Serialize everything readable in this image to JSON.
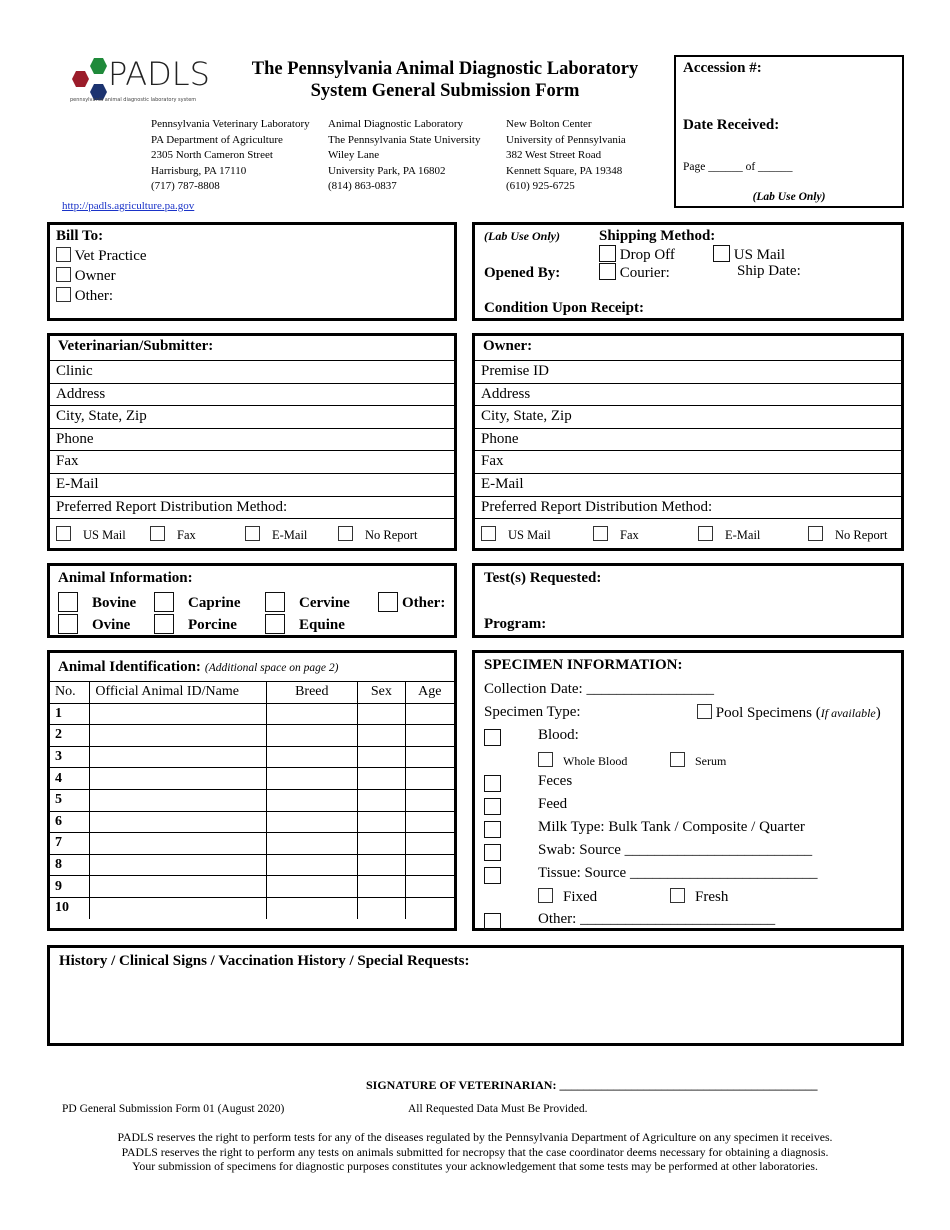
{
  "logo": {
    "wordmark": "PADLS",
    "tagline": "pennsylvania animal diagnostic laboratory system",
    "colors": {
      "green": "#1f8a3a",
      "red": "#9b1c2a",
      "blue": "#1c3370"
    }
  },
  "title": {
    "line1": "The Pennsylvania Animal Diagnostic Laboratory",
    "line2": "System General Submission Form"
  },
  "labs": [
    {
      "lines": [
        "Pennsylvania Veterinary Laboratory",
        "PA Department of Agriculture",
        "2305 North Cameron Street",
        "Harrisburg, PA  17110",
        "(717) 787-8808"
      ]
    },
    {
      "lines": [
        "Animal Diagnostic Laboratory",
        "The Pennsylvania State University",
        "Wiley Lane",
        "University Park, PA  16802",
        "(814) 863-0837"
      ]
    },
    {
      "lines": [
        "New Bolton Center",
        "University of Pennsylvania",
        "382 West Street Road",
        "Kennett Square, PA  19348",
        "(610) 925-6725"
      ]
    }
  ],
  "url": "http://padls.agriculture.pa.gov",
  "accession": {
    "label": "Accession #:",
    "date_received": "Date Received:",
    "page": "Page ______ of ______",
    "lab_use": "(Lab Use Only)"
  },
  "bill_to": {
    "title": "Bill To:",
    "options": [
      "Vet Practice",
      "Owner",
      "Other:"
    ]
  },
  "receipt": {
    "lab_use": "(Lab Use Only)",
    "shipping": "Shipping Method:",
    "drop_off": "Drop Off",
    "us_mail": "US Mail",
    "opened_by": "Opened By:",
    "courier": "Courier:",
    "ship_date": "Ship Date:",
    "condition": "Condition Upon Receipt:"
  },
  "veterinarian": {
    "title": "Veterinarian/Submitter:",
    "fields": [
      "Clinic",
      "Address",
      "City, State, Zip",
      "Phone",
      "Fax",
      "E-Mail",
      "Preferred Report Distribution Method:"
    ],
    "methods": [
      "US Mail",
      "Fax",
      "E-Mail",
      "No Report"
    ]
  },
  "owner": {
    "title": "Owner:",
    "fields": [
      "Premise ID",
      "Address",
      "City, State, Zip",
      "Phone",
      "Fax",
      "E-Mail",
      "Preferred Report Distribution Method:"
    ],
    "methods": [
      "US Mail",
      "Fax",
      "E-Mail",
      "No Report"
    ]
  },
  "animal_info": {
    "title": "Animal Information:",
    "species": [
      "Bovine",
      "Caprine",
      "Cervine",
      "Other:",
      "Ovine",
      "Porcine",
      "Equine"
    ]
  },
  "tests": {
    "title": "Test(s) Requested:",
    "program": "Program:"
  },
  "animal_id": {
    "title": "Animal Identification:",
    "note": "(Additional space on page 2)",
    "columns": [
      "No.",
      "Official Animal ID/Name",
      "Breed",
      "Sex",
      "Age"
    ],
    "rows": [
      "1",
      "2",
      "3",
      "4",
      "5",
      "6",
      "7",
      "8",
      "9",
      "10"
    ]
  },
  "specimen": {
    "title": "SPECIMEN INFORMATION:",
    "collection_date": "Collection Date: _________________",
    "type": "Specimen Type:",
    "pool": "Pool Specimens (",
    "pool_note": "If available",
    "pool_close": ")",
    "blood": "Blood:",
    "whole_blood": "Whole Blood",
    "serum": "Serum",
    "feces": "Feces",
    "feed": "Feed",
    "milk": "Milk  Type:  Bulk Tank  / Composite / Quarter",
    "swab": "Swab:  Source _________________________",
    "tissue": "Tissue: Source _________________________",
    "fixed": "Fixed",
    "fresh": "Fresh",
    "other": "Other: __________________________"
  },
  "history": {
    "title": "History / Clinical Signs / Vaccination History / Special Requests:"
  },
  "signature": "SIGNATURE OF VETERINARIAN: ___________________________________________",
  "footer": {
    "form_id": "PD General Submission Form 01 (August 2020)",
    "required": "All Requested Data Must Be Provided.",
    "disclaimer": [
      "PADLS reserves the right to perform tests for any of the diseases regulated by the Pennsylvania Department of Agriculture on any specimen it receives.",
      "PADLS reserves the right to perform any tests on animals submitted for necropsy that the case coordinator deems necessary for obtaining a diagnosis.",
      "Your submission of specimens for diagnostic purposes constitutes your acknowledgement that some tests may be performed at other laboratories."
    ]
  }
}
